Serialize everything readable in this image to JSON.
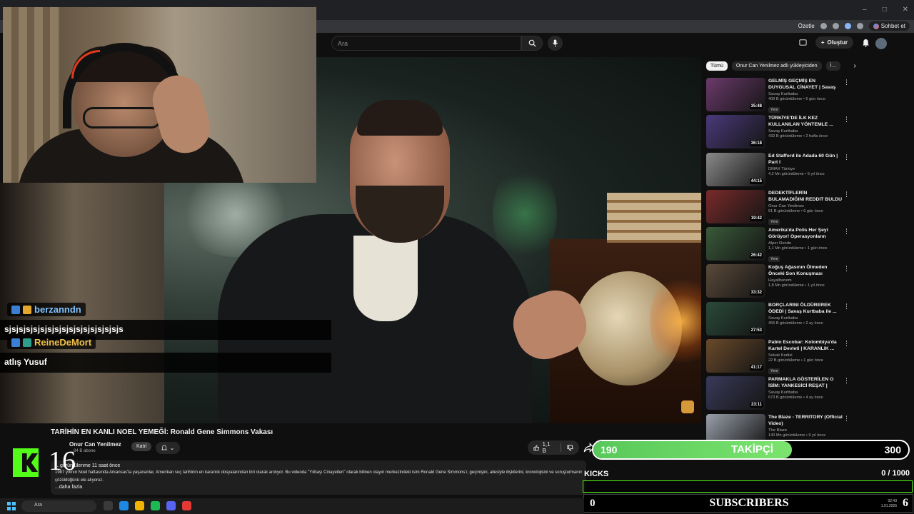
{
  "browser": {
    "summary_label": "Özetle",
    "chat_button": "Sohbet et",
    "window_controls": [
      "–",
      "□",
      "✕"
    ]
  },
  "youtube": {
    "search": {
      "placeholder": "Ara"
    },
    "create_label": "Oluştur"
  },
  "video": {
    "title": "TARİHİN EN KANLI NOEL YEMEĞİ: Ronald Gene Simmons Vakası",
    "channel": "Onur Can Yenilmez",
    "subscribers": "…84 B abone",
    "join_label": "Katıl",
    "likes": "1,1 B",
    "desc_meta": "…görüntülenme  11 saat önce",
    "desc_line1": "1987 yılının Noel haftasında Arkansas'ta yaşananlar, Amerikan suç tarihinin en karanlık dosyalarından biri olarak anılıyor. Bu videoda \"Yılbaşı Cinayetleri\" olarak bilinen olayın merkezindeki isim Ronald Gene Simmons'ı; geçmişini, ailesiyle ilişkilerini, kronolojisini ve soruşturmanın nasıl",
    "desc_line2": "çözüldüğünü ele alıyoruz.",
    "desc_more": "...daha fazla"
  },
  "chat": [
    {
      "user": "berzanndn",
      "text": "sjsjsjsjsjsjsjsjsjsjsjsjsjsjsjsjs"
    },
    {
      "user": "ReineDeMort",
      "text": "atlış Yusuf"
    }
  ],
  "kick_followers": {
    "count": "16"
  },
  "sidebar": {
    "chips": [
      "Tümü",
      "Onur Can Yenilmez adlı yükleyiciden",
      "İ…"
    ],
    "recommendations": [
      {
        "title": "GELMİŞ GEÇMİŞ EN DUYGUSAL CİNAYET | Savaş Kurtbaba ile ...",
        "channel": "Savaş Kurtbaba",
        "meta": "409 B görüntüleme • 5 gün önce",
        "badge": "Yeni",
        "duration": "35:48",
        "thumb": "#6b3a6b"
      },
      {
        "title": "TÜRKİYE'DE İLK KEZ KULLANILAN YÖNTEMLE ...",
        "channel": "Savaş Kurtbaba",
        "meta": "432 B görüntüleme • 2 hafta önce",
        "badge": "",
        "duration": "36:18",
        "thumb": "#4a3a7a"
      },
      {
        "title": "Ed Stafford ile Adada 60 Gün | Part I",
        "channel": "DMAX Türkiye",
        "meta": "4,2 Mn görüntüleme • 5 yıl önce",
        "badge": "",
        "duration": "44:15",
        "thumb": "#8a8a8a"
      },
      {
        "title": "DEDEKTİFLERİN BULAMADIĞINI REDDIT BULDU - LYLE STEVIK ...",
        "channel": "Onur Can Yenilmez",
        "meta": "51 B görüntüleme • 6 gün önce",
        "badge": "Yeni",
        "duration": "19:42",
        "thumb": "#7a2a2a"
      },
      {
        "title": "Amerika'da Polis Her Şeyi Görüyor! Operasyonların Perde...",
        "channel": "Alper Rende",
        "meta": "1,1 Mn görüntüleme • 1 gün önce",
        "badge": "Yeni",
        "duration": "26:42",
        "thumb": "#3a5a3a"
      },
      {
        "title": "Koğuş Ağasının Ölmeden Önceki Son Konuşması",
        "channel": "Hayalhanem",
        "meta": "1,8 Mn görüntüleme • 1 yıl önce",
        "badge": "",
        "duration": "33:32",
        "thumb": "#5a4a3a"
      },
      {
        "title": "BORÇLARINI ÖLDÜREREK ÖDEDİ | Savaş Kurtbaba ile ...",
        "channel": "Savaş Kurtbaba",
        "meta": "455 B görüntüleme • 2 ay önce",
        "badge": "",
        "duration": "27:53",
        "thumb": "#2a4a3a"
      },
      {
        "title": "Pablo Escobar: Kolombiya'da Kartel Devleti | KARANLIK ...",
        "channel": "Sokak Kedisi",
        "meta": "22 B görüntüleme • 1 gün önce",
        "badge": "Yeni",
        "duration": "41:17",
        "thumb": "#6a4a2a"
      },
      {
        "title": "PARMAKLA GÖSTERİLEN O İSİM: YANKESİCİ REŞAT | Sava...",
        "channel": "Savaş Kurtbaba",
        "meta": "673 B görüntüleme • 4 ay önce",
        "badge": "",
        "duration": "23:11",
        "thumb": "#3a3a5a"
      },
      {
        "title": "The Blaze - TERRITORY (Official Video)",
        "channel": "The Blaze",
        "meta": "140 Mn görüntüleme • 9 yıl önce",
        "badge": "",
        "duration": "",
        "thumb": "#9aa0aa"
      }
    ]
  },
  "stream_overlay": {
    "followers_current": "190",
    "followers_label": "TAKİPÇİ",
    "followers_goal": "300",
    "followers_progress": 0.63,
    "kicks_label": "KICKS",
    "kicks_value": "0  / 1000",
    "subs_current": "0",
    "subs_label": "SUBSCRIBERS",
    "subs_goal": "6"
  },
  "taskbar": {
    "search_placeholder": "Ara",
    "clock_time": "02:43",
    "clock_date": "1.01.2026"
  }
}
